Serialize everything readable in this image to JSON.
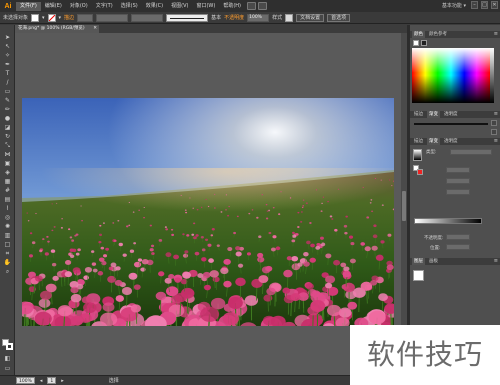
{
  "app": {
    "logo": "Ai"
  },
  "menu": {
    "items": [
      "文件(F)",
      "编辑(E)",
      "对象(O)",
      "文字(T)",
      "选择(S)",
      "效果(C)",
      "视图(V)",
      "窗口(W)",
      "帮助(H)"
    ],
    "workspace": "基本功能 ▾",
    "win_controls": [
      "–",
      "□",
      "✕"
    ]
  },
  "control_bar": {
    "selection_label": "未选择对象",
    "stroke_label": "描边",
    "stroke_value": "",
    "basic_label": "基本",
    "opacity_label": "不透明度",
    "opacity_value": "100%",
    "style_label": "样式",
    "doc_setup_label": "文档设置",
    "prefs_label": "首选项"
  },
  "document_tab": {
    "title": "花海.png* @ 100% (RGB/预览)",
    "close": "✕"
  },
  "status_bar": {
    "zoom": "100%",
    "page": "1",
    "tool_label": "选择"
  },
  "panels": {
    "color_tabs": [
      "颜色",
      "颜色参考"
    ],
    "stroke_tabs": [
      "描边",
      "渐变",
      "透明度"
    ],
    "gradient_tabs": [
      "描边",
      "渐变",
      "透明度"
    ],
    "gradient_type_label": "类型:",
    "gradient_type_value": "线性",
    "stroke_label": "描边:",
    "opacity_label": "不透明度:",
    "position_label": "位置:",
    "layers_tabs": [
      "图层",
      "画板"
    ],
    "menu_icon": "≡"
  },
  "watermark": {
    "text": "软件技巧"
  },
  "colors": {
    "accent_orange": "#ff9d2e",
    "sky_top": "#3b63b8",
    "sky_bottom": "#cfe4f5",
    "poppy": "#e04a8a",
    "field_green": "#2f5a18"
  }
}
